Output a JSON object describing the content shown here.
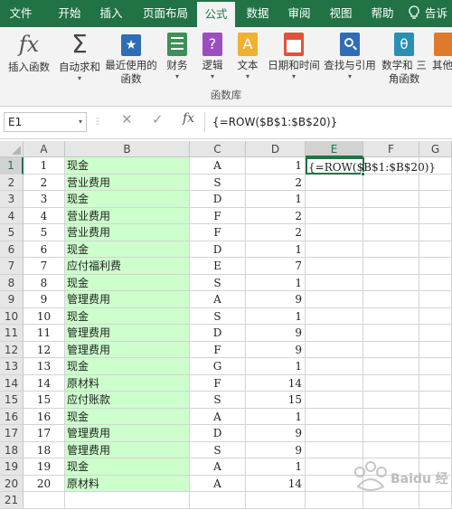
{
  "tabs": [
    "文件",
    "开始",
    "插入",
    "页面布局",
    "公式",
    "数据",
    "审阅",
    "视图",
    "帮助",
    "告诉"
  ],
  "active_tab": "公式",
  "ribbon": {
    "buttons": [
      {
        "label": "插入函数",
        "icon": "function-fx-icon"
      },
      {
        "label": "自动求和",
        "icon": "sigma-icon"
      },
      {
        "label": "最近使用的 函数",
        "icon": "recent-star-icon"
      },
      {
        "label": "财务",
        "icon": "finance-icon"
      },
      {
        "label": "逻辑",
        "icon": "logical-icon"
      },
      {
        "label": "文本",
        "icon": "text-icon"
      },
      {
        "label": "日期和时间",
        "icon": "calendar-icon"
      },
      {
        "label": "查找与引用",
        "icon": "lookup-icon"
      },
      {
        "label": "数学和 三角函数",
        "icon": "math-theta-icon"
      },
      {
        "label": "其他",
        "icon": "more-functions-icon"
      }
    ],
    "group_label": "函数库"
  },
  "formula_bar": {
    "name_box": "E1",
    "formula": "{=ROW($B$1:$B$20)}",
    "fx_symbol": "fx"
  },
  "columns": [
    "A",
    "B",
    "C",
    "D",
    "E",
    "F",
    "G"
  ],
  "rows": [
    {
      "n": "1",
      "a": "1",
      "b": "现金",
      "c": "A",
      "d": "1"
    },
    {
      "n": "2",
      "a": "2",
      "b": "营业费用",
      "c": "S",
      "d": "2"
    },
    {
      "n": "3",
      "a": "3",
      "b": "现金",
      "c": "D",
      "d": "1"
    },
    {
      "n": "4",
      "a": "4",
      "b": "营业费用",
      "c": "F",
      "d": "2"
    },
    {
      "n": "5",
      "a": "5",
      "b": "营业费用",
      "c": "F",
      "d": "2"
    },
    {
      "n": "6",
      "a": "6",
      "b": "现金",
      "c": "D",
      "d": "1"
    },
    {
      "n": "7",
      "a": "7",
      "b": "应付福利费",
      "c": "E",
      "d": "7"
    },
    {
      "n": "8",
      "a": "8",
      "b": "现金",
      "c": "S",
      "d": "1"
    },
    {
      "n": "9",
      "a": "9",
      "b": "管理费用",
      "c": "A",
      "d": "9"
    },
    {
      "n": "10",
      "a": "10",
      "b": "现金",
      "c": "S",
      "d": "1"
    },
    {
      "n": "11",
      "a": "11",
      "b": "管理费用",
      "c": "D",
      "d": "9"
    },
    {
      "n": "12",
      "a": "12",
      "b": "管理费用",
      "c": "F",
      "d": "9"
    },
    {
      "n": "13",
      "a": "13",
      "b": "现金",
      "c": "G",
      "d": "1"
    },
    {
      "n": "14",
      "a": "14",
      "b": "原材料",
      "c": "F",
      "d": "14"
    },
    {
      "n": "15",
      "a": "15",
      "b": "应付账款",
      "c": "S",
      "d": "15"
    },
    {
      "n": "16",
      "a": "16",
      "b": "现金",
      "c": "A",
      "d": "1"
    },
    {
      "n": "17",
      "a": "17",
      "b": "管理费用",
      "c": "D",
      "d": "9"
    },
    {
      "n": "18",
      "a": "18",
      "b": "管理费用",
      "c": "S",
      "d": "9"
    },
    {
      "n": "19",
      "a": "19",
      "b": "现金",
      "c": "A",
      "d": "1"
    },
    {
      "n": "20",
      "a": "20",
      "b": "原材料",
      "c": "A",
      "d": "14"
    },
    {
      "n": "21",
      "a": "",
      "b": "",
      "c": "",
      "d": ""
    }
  ],
  "e1_value": "{=ROW($B$1:$B$20)}",
  "watermark": "Baidu 经验",
  "colors": {
    "accent": "#217346",
    "highlight": "#ccffcc"
  }
}
